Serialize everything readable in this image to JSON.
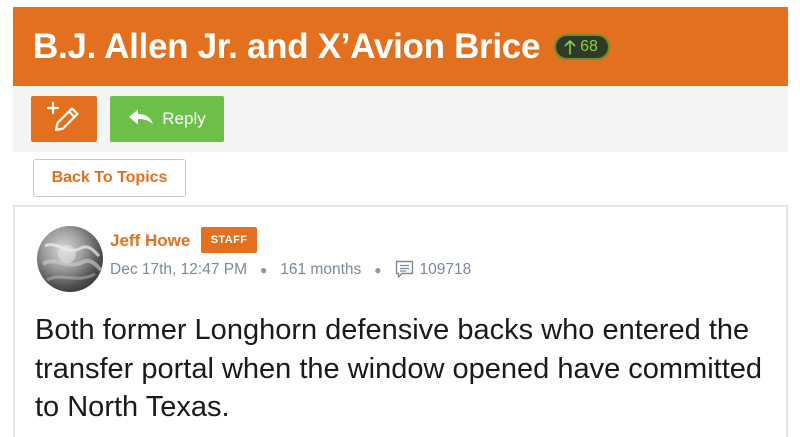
{
  "topic": {
    "title": "B.J. Allen Jr. and X’Avion Brice",
    "upvotes": "68"
  },
  "toolbar": {
    "new_post_icon": "edit-pen-plus-icon",
    "reply_icon": "reply-arrow-icon",
    "reply_label": "Reply"
  },
  "navigation": {
    "back_label": "Back To Topics"
  },
  "post": {
    "author": "Jeff Howe",
    "role_badge": "STAFF",
    "date": "Dec 17th, 12:47 PM",
    "age": "161 months",
    "comment_icon": "comment-icon",
    "views": "109718",
    "body": "Both former Longhorn defensive backs who entered the transfer portal when the window opened have committed to North Texas."
  },
  "colors": {
    "brand_orange": "#e2701f",
    "reply_green": "#6cc04a",
    "upvote_green": "#8bd13b",
    "meta_gray": "#7a8a9c"
  }
}
